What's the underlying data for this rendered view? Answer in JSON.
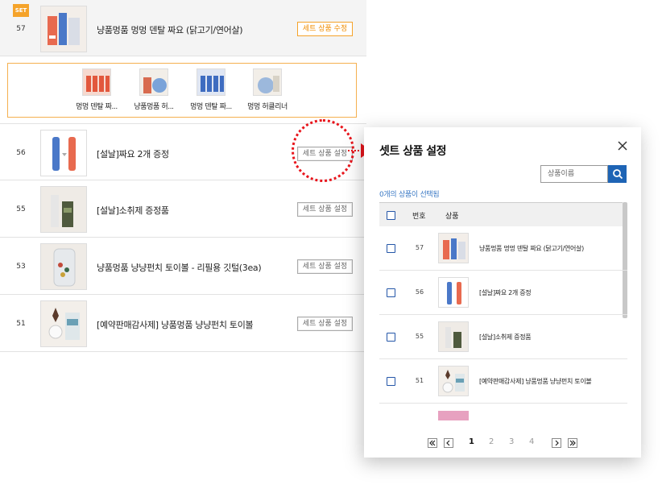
{
  "list": {
    "set_badge": "SET",
    "rows": [
      {
        "num": "57",
        "name": "냥품멍품 멍멍 덴탈 짜요 (닭고기/연어살)",
        "button": "세트 상품 수정"
      },
      {
        "num": "56",
        "name": "[설날]짜요 2개 증정",
        "button": "세트 상품 설정"
      },
      {
        "num": "55",
        "name": "[설날]소취제 증정품",
        "button": "세트 상품 설정"
      },
      {
        "num": "53",
        "name": "냥품멍품 냥냥펀치 토이볼 - 리필용 깃털(3ea)",
        "button": "세트 상품 설정"
      },
      {
        "num": "51",
        "name": "[예약판매감사제] 냥품멍품 냥냥펀치 토이볼",
        "button": "세트 상품 설정"
      }
    ],
    "set_items": [
      {
        "label": "멍멍 덴탈 짜..."
      },
      {
        "label": "냥품멍품 허..."
      },
      {
        "label": "멍멍 덴탈 짜..."
      },
      {
        "label": "멍멍 허클리너"
      }
    ]
  },
  "modal": {
    "title": "셋트 상품 설정",
    "search_placeholder": "상품이름",
    "selected_count": "0개의 상품이 선택됨",
    "columns": {
      "num": "번호",
      "product": "상품"
    },
    "rows": [
      {
        "num": "57",
        "name": "냥품멍품 멍멍 덴탈 짜요 (닭고기/연어살)"
      },
      {
        "num": "56",
        "name": "[설날]짜요 2개 증정"
      },
      {
        "num": "55",
        "name": "[설날]소취제 증정품"
      },
      {
        "num": "51",
        "name": "[예약판매감사제] 냥품멍품 냥냥펀치 토이볼"
      }
    ],
    "pagination": {
      "pages": [
        "1",
        "2",
        "3",
        "4"
      ],
      "current": "1"
    }
  },
  "colors": {
    "accent_orange": "#f5a32a",
    "callout_red": "#e8151c",
    "primary_blue": "#1e64b5",
    "link_blue": "#3b79c4"
  }
}
